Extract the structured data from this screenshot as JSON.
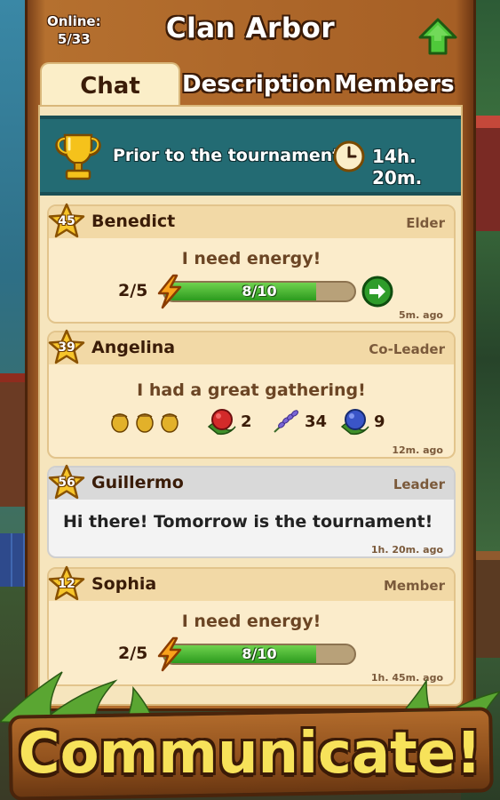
{
  "header": {
    "online_label": "Online:",
    "online_count": "5/33",
    "clan_name": "Clan Arbor"
  },
  "tabs": [
    {
      "label": "Chat",
      "active": true
    },
    {
      "label": "Description",
      "active": false
    },
    {
      "label": "Members",
      "active": false
    }
  ],
  "tournament": {
    "label": "Prior to the tournament:",
    "time": "14h. 20m."
  },
  "messages": [
    {
      "level": "45",
      "name": "Benedict",
      "role": "Elder",
      "text": "I need energy!",
      "energy": {
        "count": "2/5",
        "bar_label": "8/10",
        "fill_fraction": 0.8
      },
      "time": "5m. ago"
    },
    {
      "level": "39",
      "name": "Angelina",
      "role": "Co-Leader",
      "text": "I had a great gathering!",
      "items": [
        {
          "icon": "acorns-icon",
          "count": ""
        },
        {
          "icon": "raspberry-icon",
          "count": "2"
        },
        {
          "icon": "lavender-icon",
          "count": "34"
        },
        {
          "icon": "blueberry-icon",
          "count": "9"
        }
      ],
      "time": "12m. ago"
    },
    {
      "level": "56",
      "name": "Guillermo",
      "role": "Leader",
      "text": "Hi there! Tomorrow is the tournament!",
      "time": "1h. 20m. ago"
    },
    {
      "level": "12",
      "name": "Sophia",
      "role": "Member",
      "text": "I need energy!",
      "energy": {
        "count": "2/5",
        "bar_label": "8/10",
        "fill_fraction": 0.8
      },
      "time": "1h. 45m. ago"
    }
  ],
  "footer": {
    "banner_text": "Communicate!"
  },
  "colors": {
    "wood": "#a65f25",
    "parchment": "#f6e5bd",
    "teal_banner": "#236b73",
    "energy_green": "#2c9a1e",
    "banner_yellow": "#f7e25a"
  }
}
